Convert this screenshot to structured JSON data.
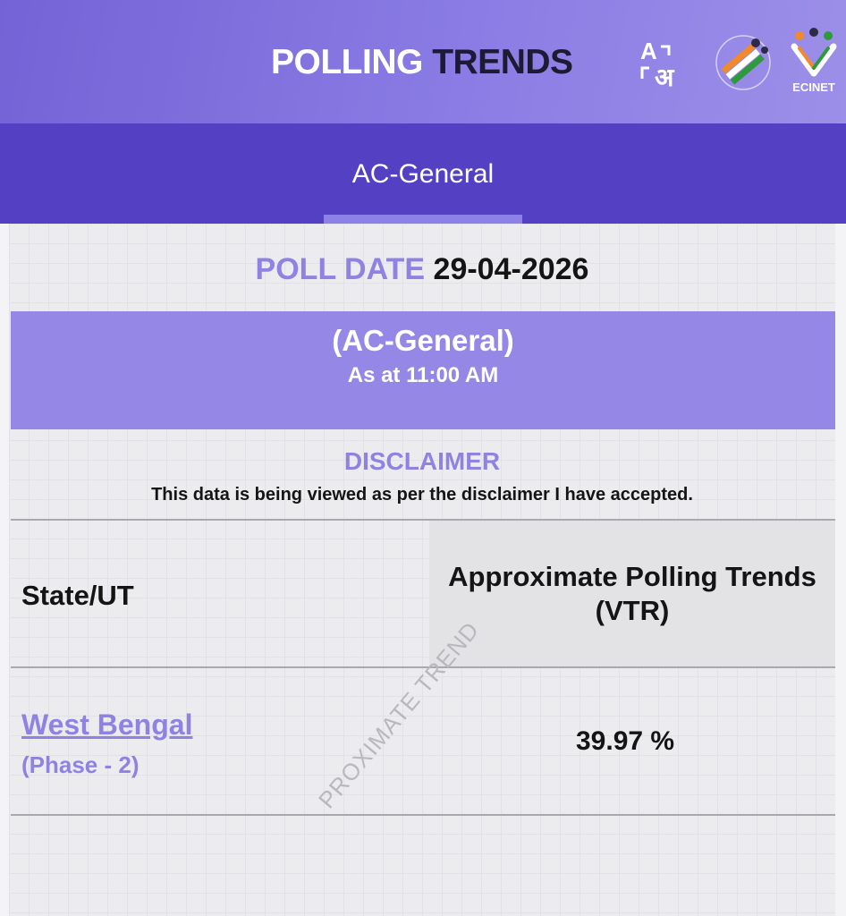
{
  "header": {
    "title_light": "POLLING",
    "title_dark": "TRENDS",
    "icons": [
      "language-toggle-icon",
      "voting-flag-icon",
      "ecinet-logo"
    ],
    "logo_text": "ECINET"
  },
  "tabs": [
    {
      "label": "AC-General",
      "active": true
    }
  ],
  "poll_date": {
    "label": "POLL DATE",
    "value": "29-04-2026"
  },
  "banner": {
    "title": "(AC-General)",
    "subtitle": "As at 11:00 AM"
  },
  "disclaimer": {
    "title": "DISCLAIMER",
    "text": "This data is being viewed as per the disclaimer I have accepted."
  },
  "table": {
    "headers": {
      "state": "State/UT",
      "trend_line1": "Approximate Polling Trends",
      "trend_line2": "(VTR)"
    },
    "rows": [
      {
        "state": "West Bengal",
        "phase": "(Phase - 2)",
        "vtr": "39.97 %"
      }
    ]
  },
  "watermark": "PROXIMATE TREND",
  "colors": {
    "accent": "#8f82e2",
    "tab_bar": "#5340c3",
    "banner": "#9487e6"
  }
}
